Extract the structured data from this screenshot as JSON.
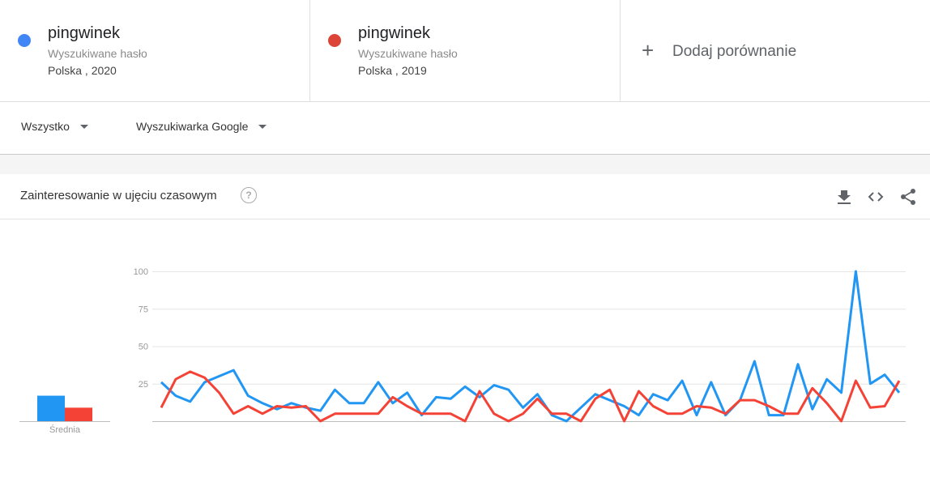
{
  "terms": [
    {
      "name": "pingwinek",
      "type": "Wyszukiwane hasło",
      "region": "Polska , 2020",
      "color": "#4285f4"
    },
    {
      "name": "pingwinek",
      "type": "Wyszukiwane hasło",
      "region": "Polska , 2019",
      "color": "#db4437"
    }
  ],
  "add_compare": {
    "label": "Dodaj porównanie",
    "icon": "plus-icon"
  },
  "filters": {
    "category": "Wszystko",
    "property": "Wyszukiwarka Google"
  },
  "card": {
    "title": "Zainteresowanie w ujęciu czasowym",
    "help_icon": "help-icon",
    "actions": [
      "download-icon",
      "embed-icon",
      "share-icon"
    ]
  },
  "average": {
    "label": "Średnia",
    "values": [
      17,
      9
    ],
    "colors": [
      "#2196f3",
      "#f44336"
    ]
  },
  "chart_data": {
    "type": "line",
    "ylim": [
      0,
      100
    ],
    "yticks": [
      "25",
      "50",
      "75",
      "100"
    ],
    "grid": true,
    "series": [
      {
        "color": "#2196f3",
        "values": [
          26,
          17,
          13,
          26,
          30,
          34,
          17,
          12,
          8,
          12,
          9,
          7,
          21,
          12,
          12,
          26,
          12,
          19,
          4,
          16,
          15,
          23,
          16,
          24,
          21,
          9,
          18,
          4,
          0,
          9,
          18,
          14,
          10,
          4,
          18,
          14,
          27,
          4,
          26,
          4,
          14,
          40,
          4,
          4,
          38,
          8,
          28,
          19,
          100,
          25,
          31,
          19
        ]
      },
      {
        "color": "#f44336",
        "values": [
          9,
          28,
          33,
          29,
          19,
          5,
          10,
          5,
          10,
          9,
          10,
          0,
          5,
          5,
          5,
          5,
          16,
          10,
          5,
          5,
          5,
          0,
          20,
          5,
          0,
          5,
          15,
          5,
          5,
          0,
          15,
          21,
          0,
          20,
          10,
          5,
          5,
          10,
          9,
          5,
          14,
          14,
          10,
          5,
          5,
          22,
          12,
          0,
          27,
          9,
          10,
          27
        ]
      }
    ]
  }
}
